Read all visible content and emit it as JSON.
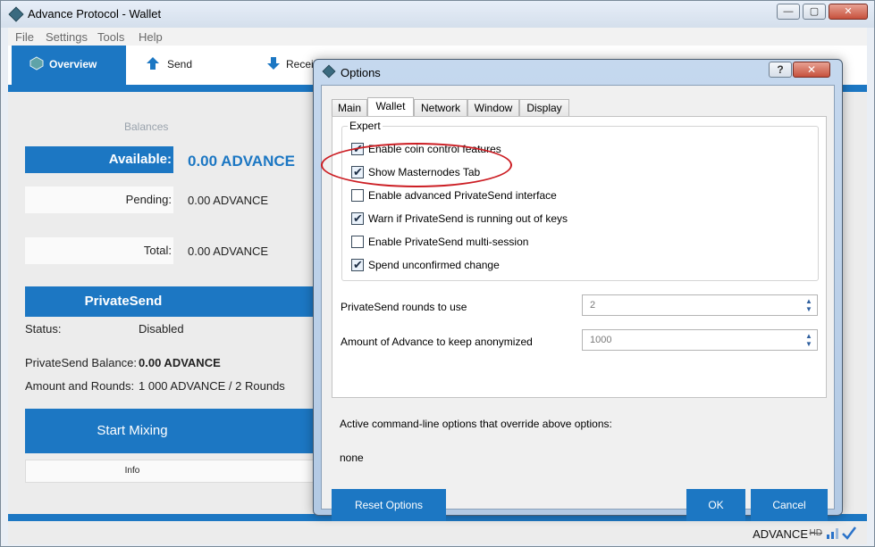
{
  "window": {
    "title": "Advance Protocol - Wallet",
    "controls": {
      "minimize": "—",
      "restore": "▢",
      "close": "✕"
    }
  },
  "menu": [
    "File",
    "Settings",
    "Tools",
    "Help"
  ],
  "toolbar": {
    "overview": "Overview",
    "send": "Send",
    "receive": "Receive"
  },
  "balances": {
    "heading": "Balances",
    "available_label": "Available:",
    "available_value": "0.00 ADVANCE",
    "pending_label": "Pending:",
    "pending_value": "0.00 ADVANCE",
    "total_label": "Total:",
    "total_value": "0.00 ADVANCE"
  },
  "privatesend": {
    "title": "PrivateSend",
    "status_label": "Status:",
    "status_value": "Disabled",
    "balance_label": "PrivateSend Balance:",
    "balance_value": "0.00 ADVANCE",
    "rounds_label": "Amount and Rounds:",
    "rounds_value": "1 000 ADVANCE / 2 Rounds",
    "start_button": "Start Mixing",
    "info_button": "Info"
  },
  "statusbar": {
    "unit": "ADVANCE",
    "hd": "HD"
  },
  "options": {
    "title": "Options",
    "help": "?",
    "close": "✕",
    "tabs": [
      "Main",
      "Wallet",
      "Network",
      "Window",
      "Display"
    ],
    "active_tab": "Wallet",
    "group_title": "Expert",
    "checkboxes": [
      {
        "label": "Enable coin control features",
        "checked": true
      },
      {
        "label": "Show Masternodes Tab",
        "checked": true
      },
      {
        "label": "Enable advanced PrivateSend interface",
        "checked": false
      },
      {
        "label": "Warn if PrivateSend is running out of keys",
        "checked": true
      },
      {
        "label": "Enable PrivateSend multi-session",
        "checked": false
      },
      {
        "label": "Spend unconfirmed change",
        "checked": true
      }
    ],
    "rounds_label": "PrivateSend rounds to use",
    "rounds_value": "2",
    "anon_label": "Amount of Advance to keep anonymized",
    "anon_value": "1000",
    "cli_label": "Active command-line options that override above options:",
    "cli_value": "none",
    "reset_button": "Reset Options",
    "ok_button": "OK",
    "cancel_button": "Cancel"
  },
  "colors": {
    "accent": "#1c77c3",
    "annotation": "#cc1e24"
  }
}
